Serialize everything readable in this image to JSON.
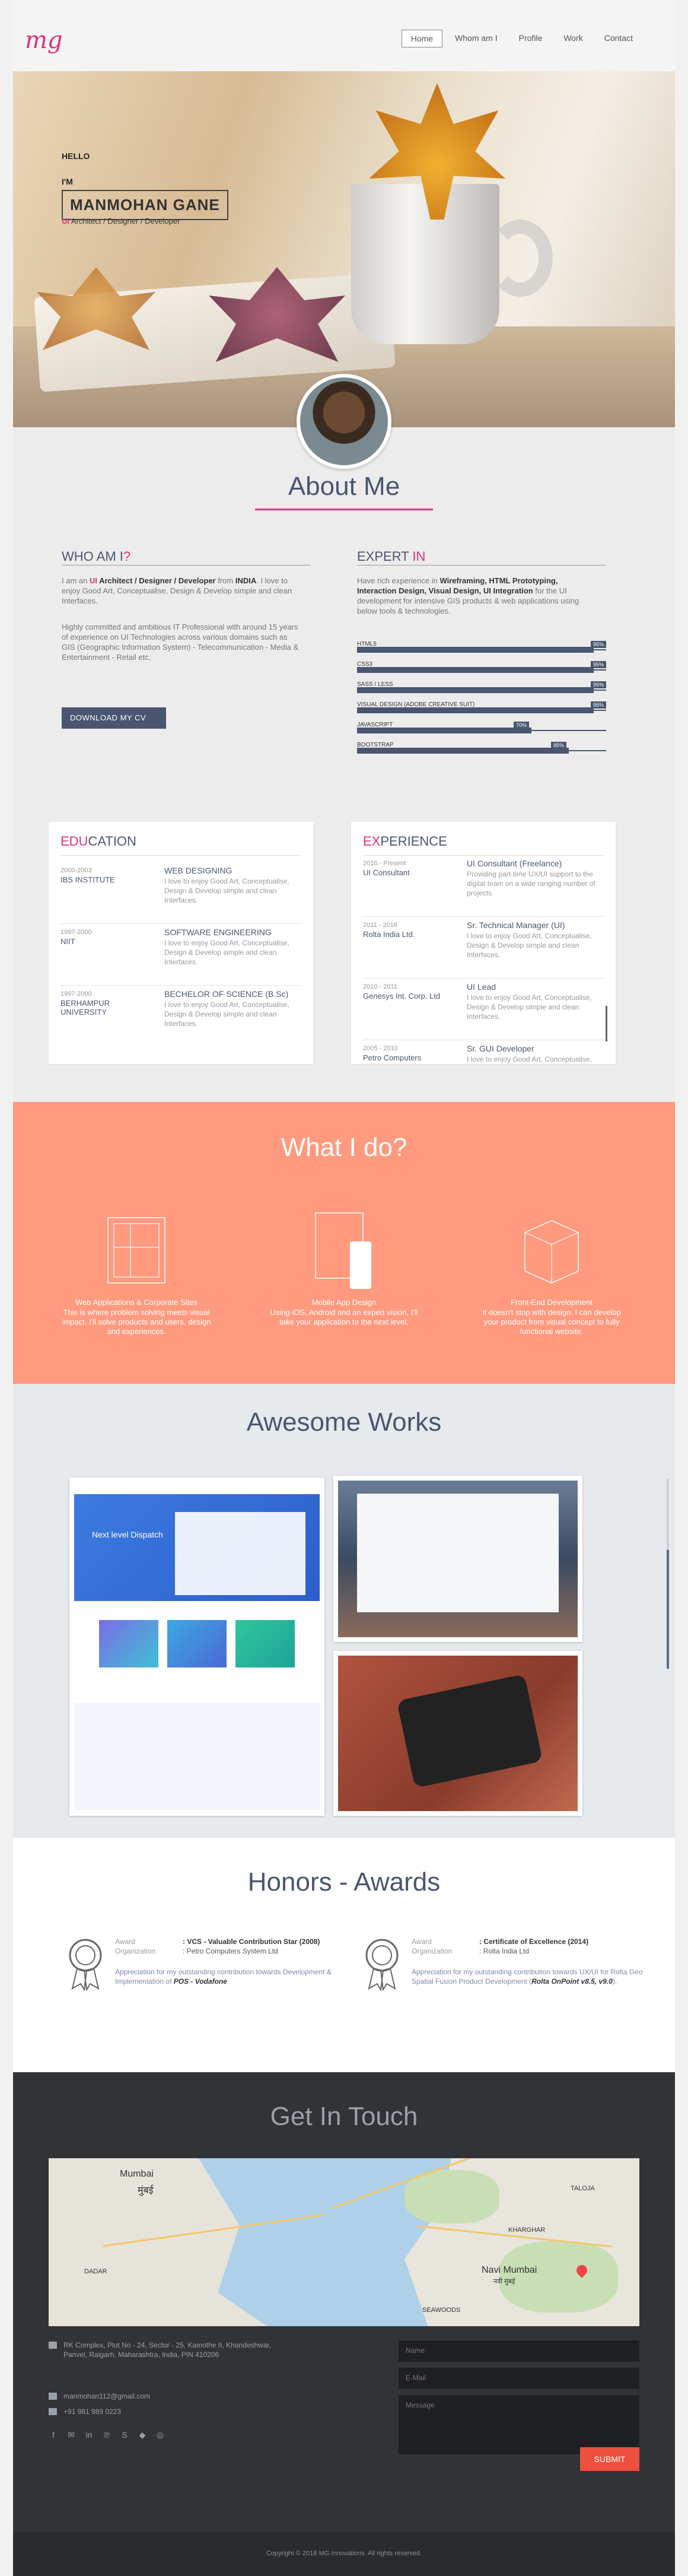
{
  "header": {
    "logo": "mg",
    "nav": [
      "Home",
      "Whom am I",
      "Profile",
      "Work",
      "Contact"
    ],
    "active_nav": "Home"
  },
  "hero": {
    "hello": "HELLO",
    "im": "I'M",
    "name": "MANMOHAN GANE",
    "role_ui": "UI",
    "role_rest": " Architect / Designer / Developer"
  },
  "about": {
    "title": "About Me",
    "who": {
      "heading_main": "WHO AM I",
      "heading_accent": "?",
      "p1_pre": "I am an ",
      "p1_ui": "UI",
      "p1_bold": " Architect / Designer / Developer",
      "p1_mid": " from ",
      "p1_india": "INDIA",
      "p1_post": ". I love to enjoy Good Art, Conceptualise, Design & Develop simple and clean Interfaces.",
      "p2": "Highly committed and ambitious IT Professional with around 15 years of experience on UI Technologies across various domains such as GIS (Geographic Information System) - Telecommunication - Media & Entertainment - Retail etc.",
      "download": "DOWNLOAD MY CV"
    },
    "expert": {
      "heading_main": "EXPERT ",
      "heading_accent": "IN",
      "p_pre": "Have rich experience in ",
      "p_bold": "Wireframing, HTML Prototyping, Interaction Design, Visual Design, UI Integration",
      "p_post": " for the UI development for intensive GIS products & web applications using below tools & technologies."
    },
    "skills": [
      {
        "label": "HTML5",
        "pct": "95%",
        "value": 95
      },
      {
        "label": "CSS3",
        "pct": "95%",
        "value": 95
      },
      {
        "label": "SASS / LESS",
        "pct": "95%",
        "value": 95
      },
      {
        "label": "VISUAL DESIGN (ADOBE CREATIVE SUIT)",
        "pct": "95%",
        "value": 95
      },
      {
        "label": "JAVASCRIPT",
        "pct": "70%",
        "value": 70
      },
      {
        "label": "BOOTSTRAP",
        "pct": "85%",
        "value": 85
      }
    ]
  },
  "education": {
    "heading_accent": "EDU",
    "heading_main": "CATION",
    "entries": [
      {
        "years": "2000-2003",
        "org": "IBS INSTITUTE",
        "title": "WEB DESIGNING",
        "desc": "I love to enjoy Good Art, Conceptualise, Design & Develop simple and clean Interfaces."
      },
      {
        "years": "1997-2000",
        "org": "NIIT",
        "title": "SOFTWARE ENGINEERING",
        "desc": "I love to enjoy Good Art, Conceptualise, Design & Develop simple and clean Interfaces."
      },
      {
        "years": "1997-2000",
        "org": "BERHAMPUR UNIVERSITY",
        "title": "BECHELOR OF SCIENCE (B.Sc)",
        "desc": "I love to enjoy Good Art, Conceptualise, Design & Develop simple and clean Interfaces."
      }
    ]
  },
  "experience": {
    "heading_accent": "EX",
    "heading_main": "PERIENCE",
    "entries": [
      {
        "years": "2016 - Present",
        "org": "UI Consultant",
        "title": "UI Consultant (Freelance)",
        "desc": "Providing part-time UX/UI support to the digital team on a wide ranging number of projects."
      },
      {
        "years": "2011 - 2016",
        "org": "Rolta India Ltd.",
        "title": "Sr. Technical Manager (UI)",
        "desc": "I love to enjoy Good Art, Conceptualise, Design & Develop simple and clean Interfaces."
      },
      {
        "years": "2010 - 2011",
        "org": "Genesys Int. Corp. Ltd",
        "title": "UI Lead",
        "desc": "I love to enjoy Good Art, Conceptualise, Design & Develop simple and clean Interfaces."
      },
      {
        "years": "2005 - 2010",
        "org": "Petro Computers",
        "title": "Sr. GUI Developer",
        "desc": "I love to enjoy Good Art, Conceptualise, Design & Develop simple and clean Interfaces."
      }
    ]
  },
  "services": {
    "title": "What I do?",
    "items": [
      {
        "icon": "web-layout-icon",
        "title": "Web Applications & Corporate Sites",
        "desc": "This is where problem solving meets visual impact. I'll solve products and users, design and experiences."
      },
      {
        "icon": "mobile-app-icon",
        "title": "Mobile App Design",
        "desc": "Using iOS, Android and an expert vision, I'll take your application to the next level."
      },
      {
        "icon": "front-end-cube-icon",
        "title": "Front-End Development",
        "desc": "It doesn't stop with design. I can develop your product from visual concept to fully functional website."
      }
    ]
  },
  "works": {
    "title": "Awesome Works",
    "shot1_heading": "Next level Dispatch"
  },
  "honors": {
    "title": "Honors - Awards",
    "awards": [
      {
        "k1": "Award",
        "v1": ": VCS - Valuable Contribution Star (2008)",
        "k2": "Organization",
        "v2": ": Petro Computers System Ltd",
        "note_pre": "Appreciation for my outstanding contribution towards Development & Implementation of ",
        "note_bold": "POS - Vodafone"
      },
      {
        "k1": "Award",
        "v1": ": Certificate of Excellence (2014)",
        "k2": "Organization",
        "v2": ": Rolta India Ltd",
        "note_pre": "Appreciation for my outstanding contribution towards UX/UI for Rolta Geo Spatial Fusion Product Development (",
        "note_bold": "Rolta OnPoint v8.5, v9.0",
        "note_post": ")."
      }
    ]
  },
  "contact": {
    "title": "Get In Touch",
    "map_labels": {
      "mumbai": "Mumbai",
      "mumbai_dev": "मुंबई",
      "navi": "Navi Mumbai",
      "navi_dev": "नवी मुंबई",
      "taloja": "TALOJA",
      "kharghar": "KHARGHAR",
      "dadar": "DADAR",
      "seawoods": "SEAWOODS"
    },
    "address": "RK Complex, Plot No - 24, Sector - 25, Kamothe II, Khandeshwar, Panvel, Raigarh, Maharashtra, India, PIN 410206",
    "email": "manmohan112@gmail.com",
    "phone": "+91 981 989 0223",
    "name_ph": "Name",
    "email_ph": "E-Mail",
    "message_ph": "Message",
    "submit": "SUBMIT"
  },
  "footer": {
    "copyright": "Copyright © 2018 MG Innovations. All rights reserved."
  }
}
